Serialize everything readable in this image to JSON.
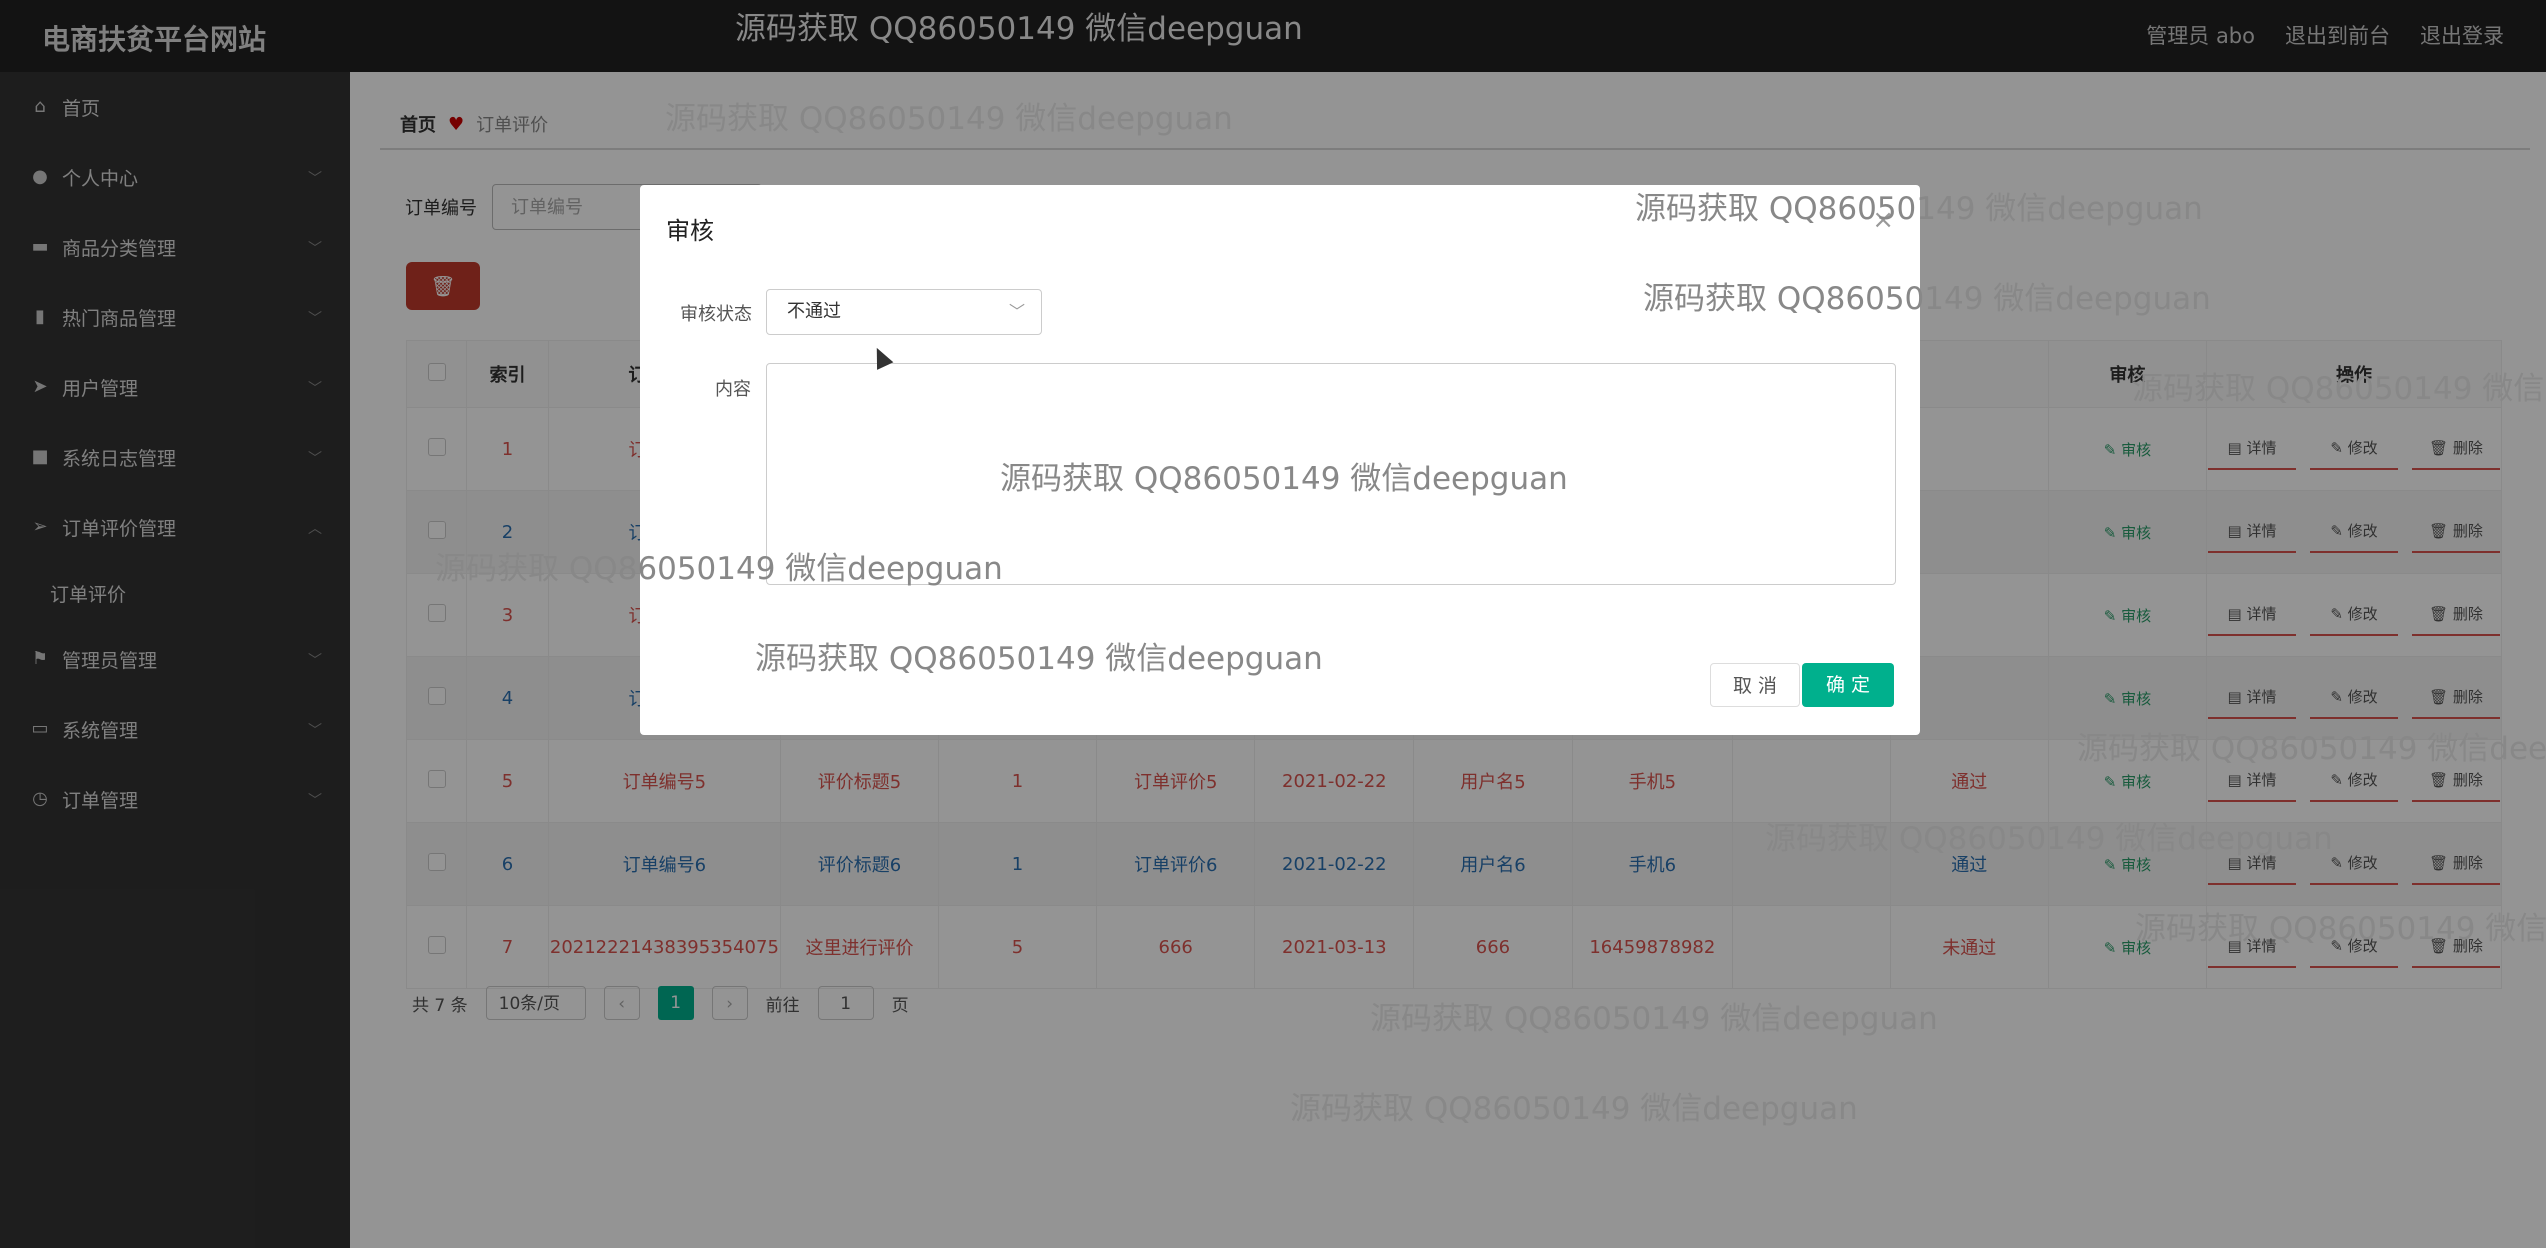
{
  "topbar": {
    "brand": "电商扶贫平台网站",
    "admin": "管理员 abo",
    "to_front": "退出到前台",
    "logout": "退出登录"
  },
  "sidebar": {
    "items": [
      {
        "label": "首页",
        "icon": "home-icon"
      },
      {
        "label": "个人中心",
        "icon": "user-icon"
      },
      {
        "label": "商品分类管理",
        "icon": "comment-icon"
      },
      {
        "label": "热门商品管理",
        "icon": "bar-chart-icon"
      },
      {
        "label": "用户管理",
        "icon": "send-icon"
      },
      {
        "label": "系统日志管理",
        "icon": "briefcase-icon"
      },
      {
        "label": "订单评价管理",
        "icon": "paper-plane-icon"
      },
      {
        "label": "管理员管理",
        "icon": "flag-icon"
      },
      {
        "label": "系统管理",
        "icon": "id-card-icon"
      },
      {
        "label": "订单管理",
        "icon": "clock-icon"
      }
    ],
    "sub_item": "订单评价"
  },
  "breadcrumb": {
    "home": "首页",
    "current": "订单评价"
  },
  "search": {
    "label": "订单编号",
    "placeholder": "订单编号"
  },
  "table": {
    "headers": [
      "索引",
      "订单编号",
      "审核",
      "操作"
    ],
    "rows": [
      {
        "index": "1",
        "order_no": "订单编号",
        "title": "",
        "qty": "",
        "review": "",
        "date": "",
        "user": "",
        "phone": "",
        "status": "",
        "color": "red"
      },
      {
        "index": "2",
        "order_no": "订单编号",
        "title": "",
        "qty": "",
        "review": "",
        "date": "",
        "user": "",
        "phone": "",
        "status": "",
        "color": "blue"
      },
      {
        "index": "3",
        "order_no": "订单编号",
        "title": "",
        "qty": "",
        "review": "",
        "date": "",
        "user": "",
        "phone": "",
        "status": "",
        "color": "red"
      },
      {
        "index": "4",
        "order_no": "订单编号",
        "title": "",
        "qty": "",
        "review": "",
        "date": "",
        "user": "",
        "phone": "",
        "status": "",
        "color": "blue"
      },
      {
        "index": "5",
        "order_no": "订单编号5",
        "title": "评价标题5",
        "qty": "1",
        "review": "订单评价5",
        "date": "2021-02-22",
        "user": "用户名5",
        "phone": "手机5",
        "status": "通过",
        "color": "red"
      },
      {
        "index": "6",
        "order_no": "订单编号6",
        "title": "评价标题6",
        "qty": "1",
        "review": "订单评价6",
        "date": "2021-02-22",
        "user": "用户名6",
        "phone": "手机6",
        "status": "通过",
        "color": "blue"
      },
      {
        "index": "7",
        "order_no": "20212221438395354075",
        "title": "这里进行评价",
        "qty": "5",
        "review": "666",
        "date": "2021-03-13",
        "user": "666",
        "phone": "16459878982",
        "status": "未通过",
        "color": "red"
      }
    ],
    "audit_link": "审核",
    "op_detail": "详情",
    "op_edit": "修改",
    "op_delete": "删除"
  },
  "pager": {
    "total": "共 7 条",
    "page_size": "10条/页",
    "current": "1",
    "goto": "前往",
    "goto_value": "1",
    "page_unit": "页"
  },
  "dialog": {
    "title": "审核",
    "status_label": "审核状态",
    "status_value": "不通过",
    "content_label": "内容",
    "cancel": "取 消",
    "ok": "确 定"
  },
  "watermark": "源码获取 QQ86050149 微信deepguan",
  "colors": {
    "accent": "#00b08d",
    "danger": "#c0392b",
    "sidebar": "#333333",
    "topbar": "#222222"
  }
}
